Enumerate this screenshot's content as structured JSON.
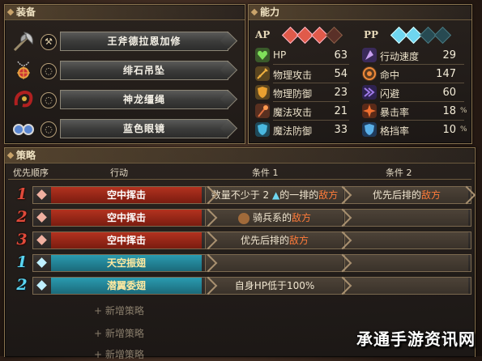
{
  "equipment": {
    "title": "装备",
    "items": [
      {
        "name": "王斧德拉恩加修",
        "type_icon": "axe-icon",
        "item_icon": "axe-weapon-icon",
        "type_glyph": "⚒"
      },
      {
        "name": "绯石吊坠",
        "type_icon": "ring-icon",
        "item_icon": "pendant-icon",
        "type_glyph": "◌"
      },
      {
        "name": "神龙缰绳",
        "type_icon": "ring-icon",
        "item_icon": "dragon-reins-icon",
        "type_glyph": "◌"
      },
      {
        "name": "蓝色眼镜",
        "type_icon": "ring-icon",
        "item_icon": "glasses-icon",
        "type_glyph": "◌"
      }
    ]
  },
  "stats": {
    "title": "能力",
    "ap_label": "AP",
    "pp_label": "PP",
    "ap_gems": {
      "filled": 3,
      "total": 4,
      "color": "#e05a4a"
    },
    "pp_gems": {
      "filled": 2,
      "total": 4,
      "color": "#6fd6f0"
    },
    "left": [
      {
        "name": "HP",
        "value": "63",
        "icon": "heart-icon",
        "color": "#6fcf4a"
      },
      {
        "name": "物理攻击",
        "value": "54",
        "icon": "sword-icon",
        "color": "#e9a030"
      },
      {
        "name": "物理防御",
        "value": "23",
        "icon": "shield-icon",
        "color": "#e0a030"
      },
      {
        "name": "魔法攻击",
        "value": "21",
        "icon": "staff-icon",
        "color": "#e07040"
      },
      {
        "name": "魔法防御",
        "value": "33",
        "icon": "magic-shield-icon",
        "color": "#4ab8e0"
      }
    ],
    "right": [
      {
        "name": "行动速度",
        "value": "29",
        "unit": "",
        "icon": "speed-icon",
        "color": "#b68ae0"
      },
      {
        "name": "命中",
        "value": "147",
        "unit": "",
        "icon": "target-icon",
        "color": "#f08a3a"
      },
      {
        "name": "闪避",
        "value": "60",
        "unit": "",
        "icon": "dodge-icon",
        "color": "#9a6ae0"
      },
      {
        "name": "暴击率",
        "value": "18",
        "unit": "%",
        "icon": "critical-icon",
        "color": "#f07030"
      },
      {
        "name": "格挡率",
        "value": "10",
        "unit": "%",
        "icon": "block-icon",
        "color": "#5ab0e8"
      }
    ]
  },
  "strategy": {
    "title": "策略",
    "headers": {
      "priority": "优先顺序",
      "action": "行动",
      "cond1": "条件 1",
      "cond2": "条件 2"
    },
    "rows": [
      {
        "prio": "1",
        "kind": "red",
        "action": "空中挥击",
        "c1_pre": "数量不少于 2 ",
        "c1_icon": "▲",
        "c1_mid": "的一排的",
        "c1_hl": "敌方",
        "c2_pre": "优先后排的",
        "c2_hl": "敌方"
      },
      {
        "prio": "2",
        "kind": "red",
        "action": "空中挥击",
        "c1_pre": "骑兵系的",
        "c1_icon": "",
        "c1_mid": "",
        "c1_hl": "敌方",
        "c2_pre": "",
        "c2_hl": ""
      },
      {
        "prio": "3",
        "kind": "red",
        "action": "空中挥击",
        "c1_pre": "优先后排的",
        "c1_icon": "",
        "c1_mid": "",
        "c1_hl": "敌方",
        "c2_pre": "",
        "c2_hl": ""
      },
      {
        "prio": "1",
        "kind": "blue",
        "action": "天空振翅",
        "c1_pre": "",
        "c1_icon": "",
        "c1_mid": "",
        "c1_hl": "",
        "c2_pre": "",
        "c2_hl": ""
      },
      {
        "prio": "2",
        "kind": "blue",
        "action": "潜翼委翅",
        "c1_pre": "自身HP低于100%",
        "c1_icon": "",
        "c1_mid": "",
        "c1_hl": "",
        "c2_pre": "",
        "c2_hl": ""
      }
    ],
    "add_label": "+ 新增策略"
  },
  "watermark": "承通手游资讯网"
}
